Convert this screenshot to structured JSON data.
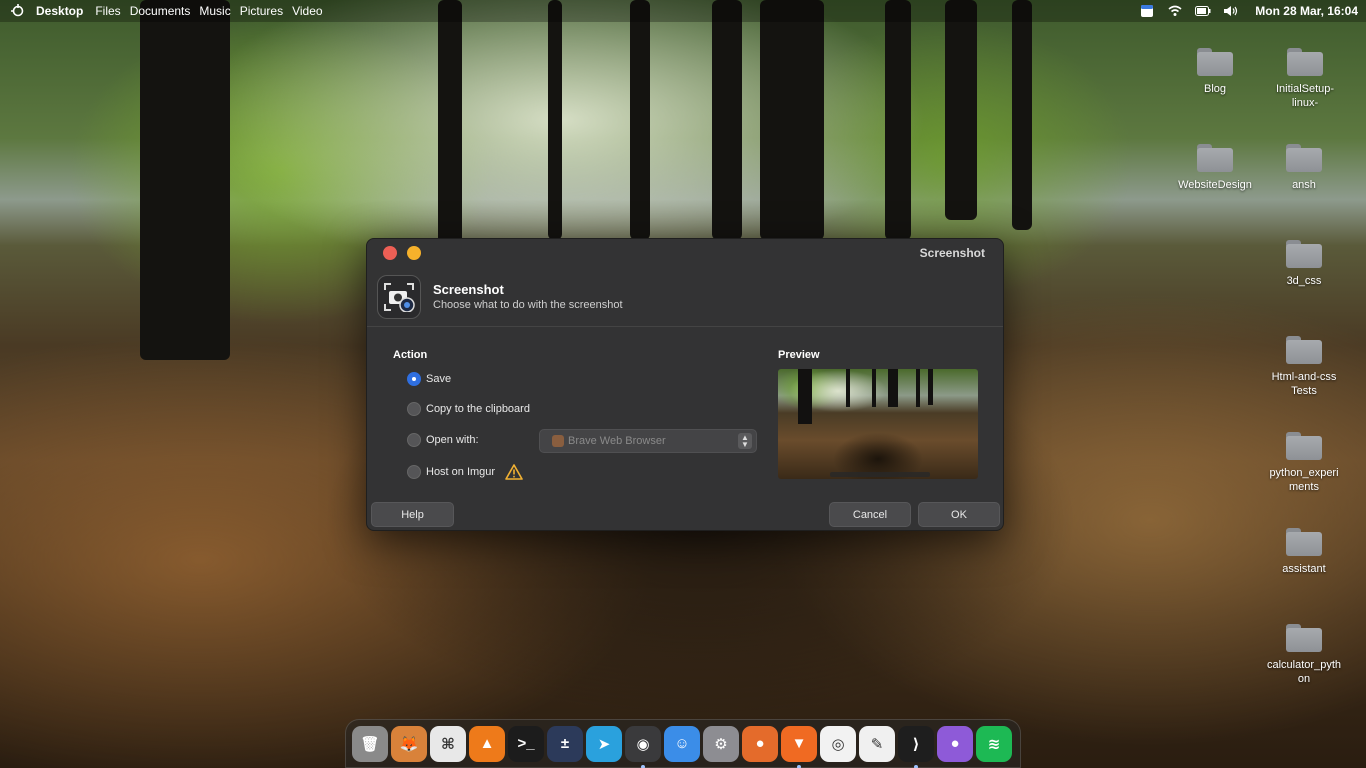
{
  "menubar": {
    "logo_icon": "launcher-icon",
    "items": [
      "Desktop",
      "Files",
      "Documents",
      "Music",
      "Pictures",
      "Video"
    ],
    "status_icons": [
      "calendar-icon",
      "wifi-icon",
      "battery-icon",
      "volume-icon"
    ],
    "clock": "Mon 28 Mar, 16:04"
  },
  "desktop": {
    "icons": [
      {
        "label": "Blog"
      },
      {
        "label": "InitialSetup-linux-"
      },
      {
        "label": "WebsiteDesign"
      },
      {
        "label": "ansh"
      },
      {
        "label": "3d_css"
      },
      {
        "label": "Html-and-css Tests"
      },
      {
        "label": "python_experiments"
      },
      {
        "label": "assistant"
      },
      {
        "label": "calculator_python"
      }
    ]
  },
  "dialog": {
    "window_title": "Screenshot",
    "header_title": "Screenshot",
    "header_subtitle": "Choose what to do with the screenshot",
    "action_label": "Action",
    "preview_label": "Preview",
    "options": [
      {
        "label": "Save",
        "checked": true
      },
      {
        "label": "Copy to the clipboard",
        "checked": false
      },
      {
        "label": "Open with:",
        "checked": false
      },
      {
        "label": "Host on Imgur",
        "checked": false
      }
    ],
    "open_with_value": "Brave Web Browser",
    "help_button": "Help",
    "cancel_button": "Cancel",
    "ok_button": "OK",
    "accent_color": "#2f6fe0"
  },
  "dock": {
    "apps": [
      {
        "name": "trash-icon",
        "glyph": "🗑",
        "bg": "#8a8a8a",
        "running": false
      },
      {
        "name": "gimp-icon",
        "glyph": "🦊",
        "bg": "#d9823a",
        "running": false
      },
      {
        "name": "keyboard-shortcuts-icon",
        "glyph": "⌘",
        "bg": "#e8e8e8",
        "running": false
      },
      {
        "name": "vlc-icon",
        "glyph": "▲",
        "bg": "#ee7a1a",
        "running": false
      },
      {
        "name": "terminal-icon",
        "glyph": ">_",
        "bg": "#1c1c1c",
        "running": false
      },
      {
        "name": "calculator-icon",
        "glyph": "±",
        "bg": "#2c3a5a",
        "running": false
      },
      {
        "name": "telegram-icon",
        "glyph": "➤",
        "bg": "#2aa1dd",
        "running": false
      },
      {
        "name": "screenshot-icon",
        "glyph": "◉",
        "bg": "#3a3a3c",
        "running": true
      },
      {
        "name": "finder-icon",
        "glyph": "☺",
        "bg": "#3b8de8",
        "running": false
      },
      {
        "name": "settings-icon",
        "glyph": "⚙",
        "bg": "#8d8d92",
        "running": false
      },
      {
        "name": "firefox-icon",
        "glyph": "●",
        "bg": "#e46b2b",
        "running": false
      },
      {
        "name": "brave-icon",
        "glyph": "▼",
        "bg": "#f06a22",
        "running": true
      },
      {
        "name": "camera-icon",
        "glyph": "◎",
        "bg": "#f2f2f2",
        "running": false
      },
      {
        "name": "text-editor-icon",
        "glyph": "✎",
        "bg": "#f0f0f0",
        "running": false
      },
      {
        "name": "vscode-icon",
        "glyph": "⟩",
        "bg": "#1e1e1e",
        "running": true
      },
      {
        "name": "github-icon",
        "glyph": "●",
        "bg": "#8e5ad8",
        "running": false
      },
      {
        "name": "spotify-icon",
        "glyph": "≋",
        "bg": "#1db954",
        "running": false
      }
    ]
  }
}
